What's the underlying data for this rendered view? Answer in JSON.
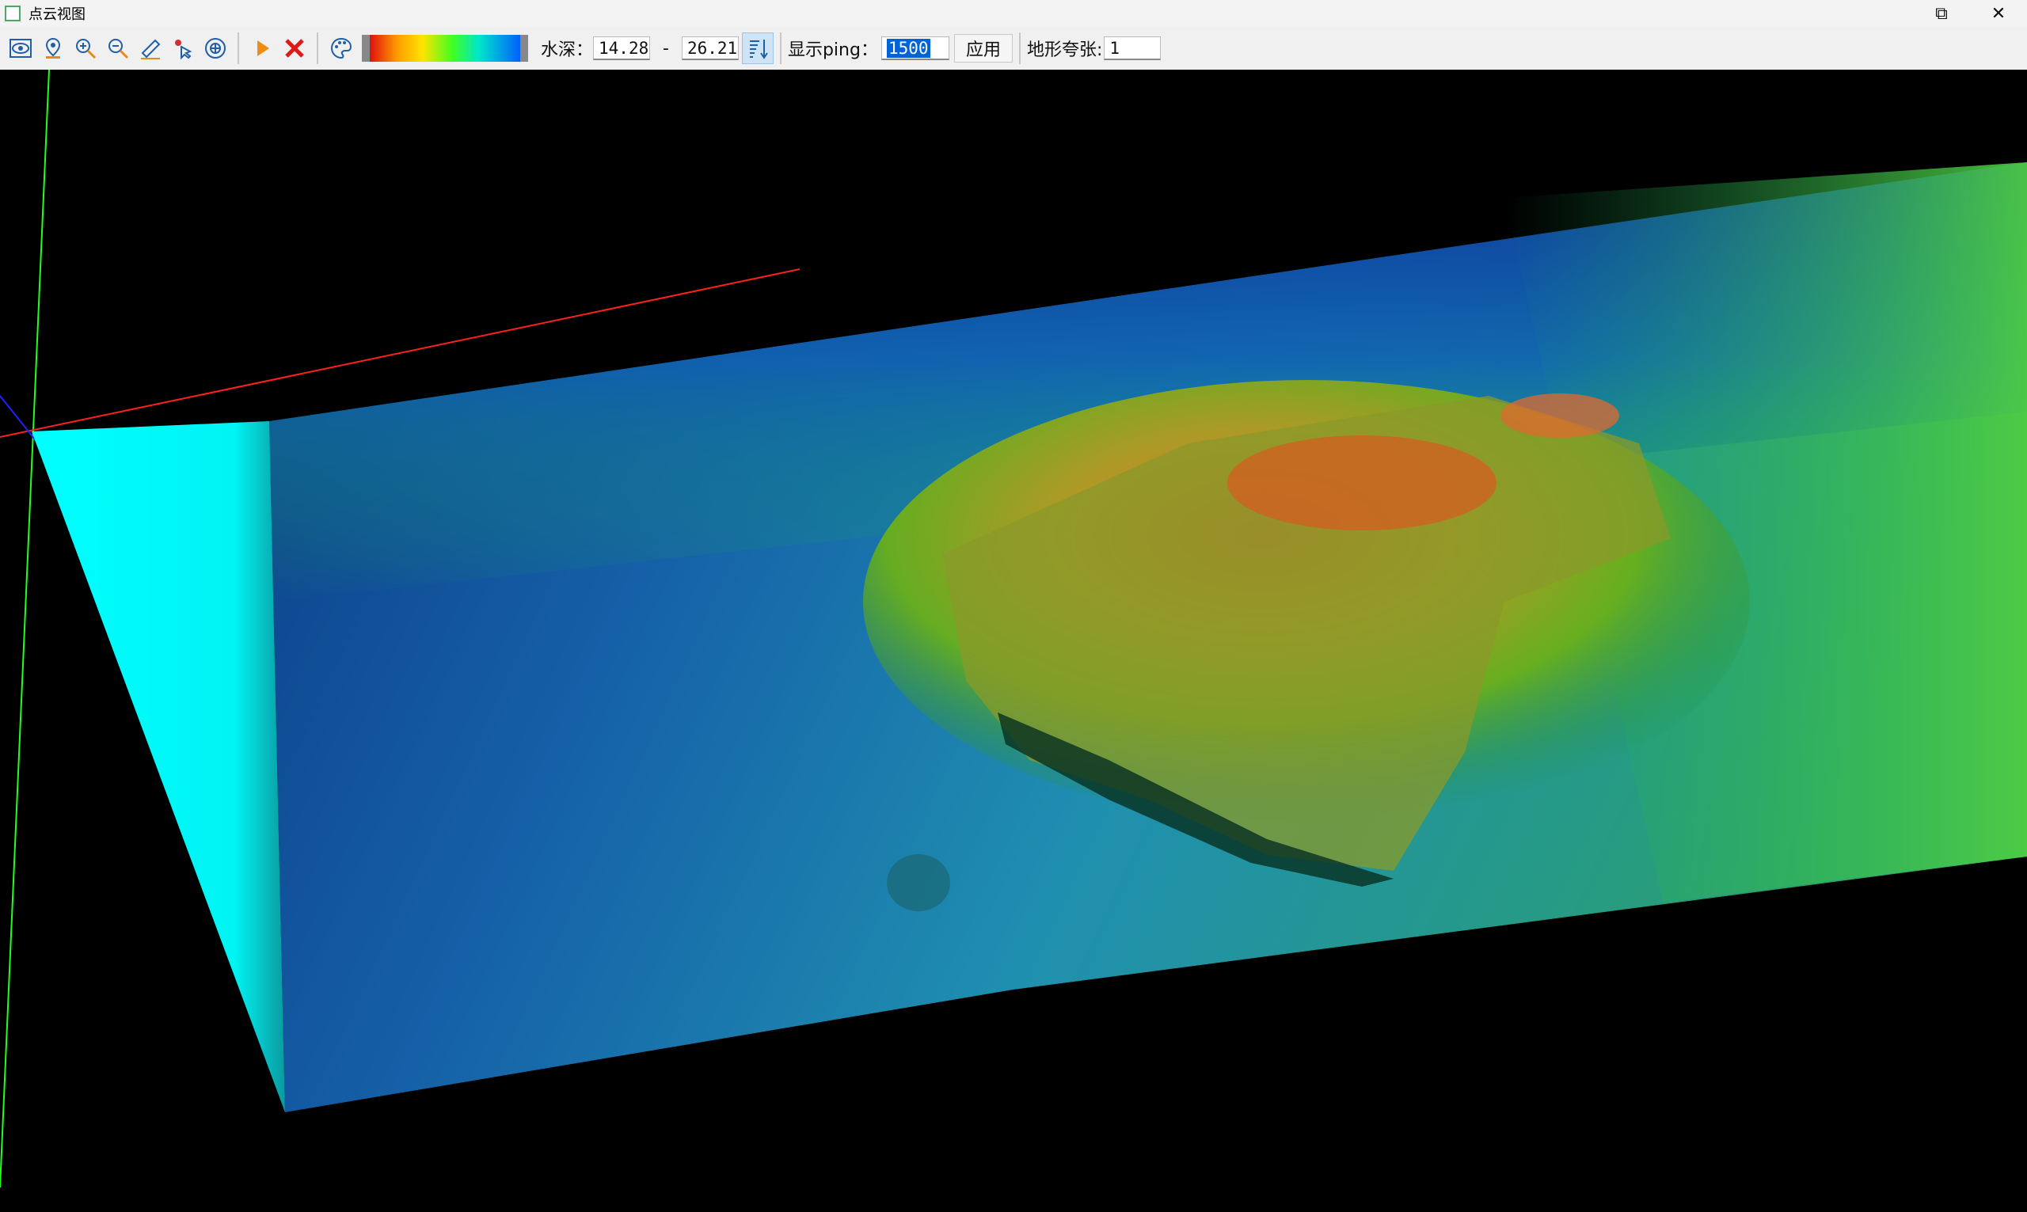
{
  "window": {
    "title": "点云视图",
    "restore_glyph": "⧉",
    "close_glyph": "✕"
  },
  "toolbar": {
    "depth_label": "水深：",
    "depth_min": "14.28",
    "depth_separator": "-",
    "depth_max": "26.21",
    "ping_label": "显示ping：",
    "ping_value": "1500",
    "apply_label": "应用",
    "exaggeration_label": "地形夸张:",
    "exaggeration_value": "1",
    "icons": [
      "eye-icon",
      "location-pin-icon",
      "zoom-in-icon",
      "zoom-out-icon",
      "ruler-icon",
      "pointer-pick-icon",
      "target-icon",
      "play-icon",
      "close-red-icon",
      "palette-icon",
      "sort-icon"
    ]
  },
  "colors": {
    "scale": [
      "#e01010",
      "#ff9a00",
      "#ffe400",
      "#40ff20",
      "#00e8c8",
      "#0060ff"
    ],
    "axis_x": "#ff2020",
    "axis_y": "#20ff20",
    "axis_z": "#2020ff",
    "side_wall": "#00ffff"
  }
}
